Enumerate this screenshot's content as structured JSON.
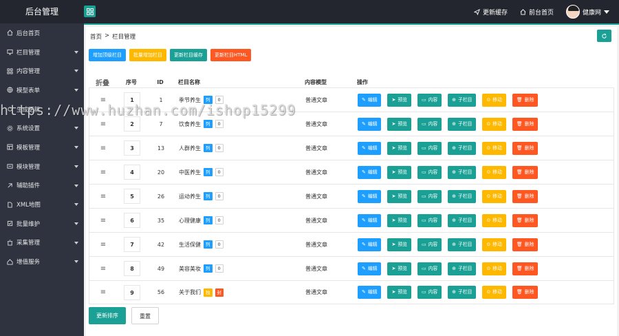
{
  "header": {
    "brand": "后台管理",
    "update_cache": "更新缓存",
    "front_home": "前台首页",
    "user_name": "健康网"
  },
  "sidebar": {
    "items": [
      {
        "label": "后台首页",
        "icon": "home-icon",
        "has_arrow": false
      },
      {
        "label": "栏目管理",
        "icon": "monitor-icon",
        "has_arrow": true
      },
      {
        "label": "内容管理",
        "icon": "apps-icon",
        "has_arrow": true
      },
      {
        "label": "模型表单",
        "icon": "globe-icon",
        "has_arrow": true
      },
      {
        "label": "生成更新",
        "icon": "refresh-icon",
        "has_arrow": false
      },
      {
        "label": "系统设置",
        "icon": "gear-icon",
        "has_arrow": true
      },
      {
        "label": "模板管理",
        "icon": "template-icon",
        "has_arrow": true
      },
      {
        "label": "模块管理",
        "icon": "module-icon",
        "has_arrow": true
      },
      {
        "label": "辅助插件",
        "icon": "plugin-icon",
        "has_arrow": true
      },
      {
        "label": "XML地图",
        "icon": "file-icon",
        "has_arrow": true
      },
      {
        "label": "批量维护",
        "icon": "batch-icon",
        "has_arrow": true
      },
      {
        "label": "采集管理",
        "icon": "collect-icon",
        "has_arrow": true
      },
      {
        "label": "增值服务",
        "icon": "service-icon",
        "has_arrow": true
      }
    ]
  },
  "breadcrumb": {
    "home": "首页",
    "sep": ">",
    "current": "栏目管理"
  },
  "toolbar": {
    "add_top": "增加顶级栏目",
    "batch_add": "批量增加栏目",
    "update_cache": "更新栏目缓存",
    "update_html": "更新栏目HTML"
  },
  "table": {
    "headers": {
      "fold": "折叠",
      "sort": "序号",
      "id": "ID",
      "name": "栏目名称",
      "model": "内容模型",
      "ops": "操作"
    },
    "op_labels": {
      "edit": "编辑",
      "preview": "预览",
      "content": "内容",
      "child": "子栏目",
      "move": "移动",
      "delete": "删除"
    },
    "rows": [
      {
        "sort": "1",
        "id": "1",
        "name": "季节养生",
        "tag1": "列",
        "tag2": "0",
        "model": "普通文章",
        "tag_style": "list"
      },
      {
        "sort": "2",
        "id": "7",
        "name": "饮食养生",
        "tag1": "列",
        "tag2": "0",
        "model": "普通文章",
        "tag_style": "list"
      },
      {
        "sort": "3",
        "id": "13",
        "name": "人群养生",
        "tag1": "列",
        "tag2": "0",
        "model": "普通文章",
        "tag_style": "list"
      },
      {
        "sort": "4",
        "id": "20",
        "name": "中医养生",
        "tag1": "列",
        "tag2": "0",
        "model": "普通文章",
        "tag_style": "list"
      },
      {
        "sort": "5",
        "id": "26",
        "name": "运动养生",
        "tag1": "列",
        "tag2": "0",
        "model": "普通文章",
        "tag_style": "list"
      },
      {
        "sort": "6",
        "id": "35",
        "name": "心理健康",
        "tag1": "列",
        "tag2": "0",
        "model": "普通文章",
        "tag_style": "list"
      },
      {
        "sort": "7",
        "id": "42",
        "name": "生活保健",
        "tag1": "列",
        "tag2": "0",
        "model": "普通文章",
        "tag_style": "list"
      },
      {
        "sort": "8",
        "id": "49",
        "name": "美容美妆",
        "tag1": "列",
        "tag2": "0",
        "model": "普通文章",
        "tag_style": "list"
      },
      {
        "sort": "9",
        "id": "56",
        "name": "关于我们",
        "tag1": "独",
        "tag2": "封",
        "model": "普通文章",
        "tag_style": "single"
      }
    ]
  },
  "footer": {
    "update_sort": "更新排序",
    "reset": "重置"
  },
  "watermark": "https://www.huzhan.com/ishop15299",
  "colors": {
    "teal": "#1aa094",
    "blue": "#1e9fff",
    "yellow": "#ffb800",
    "orange": "#ff5722",
    "sidebar": "#2f3340",
    "topbar": "#23262e"
  }
}
